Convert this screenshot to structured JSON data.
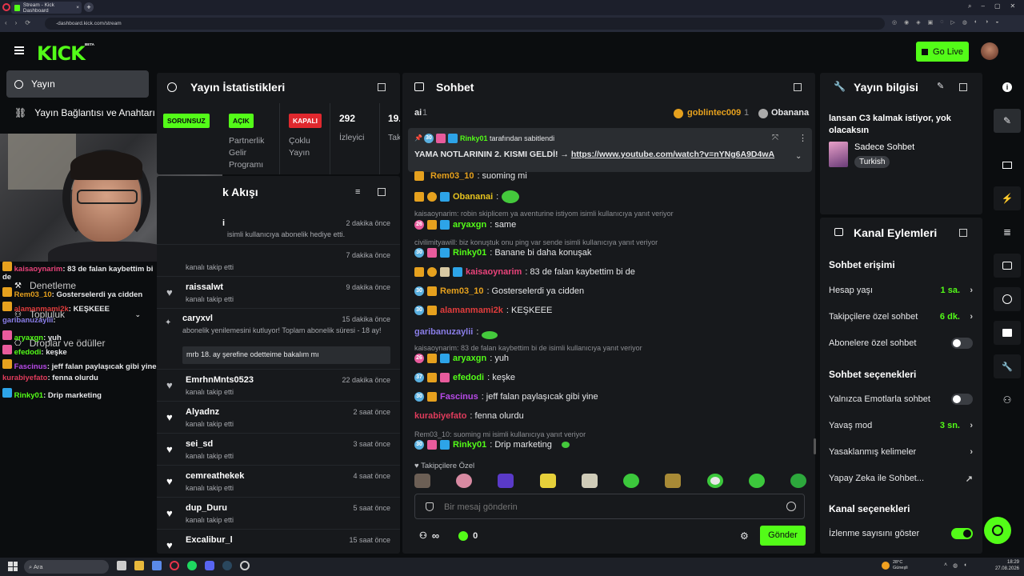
{
  "browser": {
    "tab_title": "Stream - Kick Dashboard",
    "url": "-dashboard.kick.com/stream"
  },
  "header": {
    "logo": "KICK",
    "beta": "BETA",
    "go_live_label": "Go Live"
  },
  "sidebar": {
    "items": [
      {
        "label": "Yayın"
      },
      {
        "label": "Yayın Bağlantısı ve Anahtarı"
      },
      {
        "label": "Denetleme"
      },
      {
        "label": "Topluluk"
      },
      {
        "label": "Droplar ve ödüller"
      }
    ]
  },
  "overlay_chat": {
    "lines": [
      {
        "user": "kaisaoynarim",
        "text": ": 83 de falan kaybettim bi"
      },
      {
        "user": "",
        "text": "de"
      },
      {
        "user": "Rem03_10",
        "text": ": Gosterselerdi ya cidden"
      },
      {
        "user": "alamanmami2k",
        "text": ": KEŞKEEE"
      },
      {
        "user": "garibanuzaylii",
        "text": ":"
      },
      {
        "user": "aryaxgn",
        "text": ": yuh"
      },
      {
        "user": "efedodi",
        "text": ": keşke"
      },
      {
        "user": "Fascinus",
        "text": ": jeff falan paylaşıcak gibi yine"
      },
      {
        "user": "kurabiyefato",
        "text": ": fenna olurdu"
      },
      {
        "user": "Rinky01",
        "text": ": Drip marketing"
      }
    ]
  },
  "stats": {
    "title": "Yayın İstatistikleri",
    "badges": [
      "SORUNSUZ",
      "AÇIK",
      "KAPALI"
    ],
    "partner_label": "Partnerlik Gelir Programı",
    "multi_label": "Çoklu Yayın",
    "viewers": "292",
    "viewers_label": "İzleyici",
    "partial_value": "19.",
    "partial_label": "Tak"
  },
  "activity": {
    "title": "k Akışı",
    "rows": [
      {
        "name": "i",
        "sub": "isimli kullanıcıya abonelik hediye etti.",
        "time": "2 dakika önce"
      },
      {
        "name": "",
        "sub": "kanalı takip etti",
        "time": "7 dakika önce"
      },
      {
        "name": "raissalwt",
        "sub": "kanalı takip etti",
        "time": "9 dakika önce"
      },
      {
        "name": "caryxvl",
        "sub": "abonelik yenilemesini kutluyor! Toplam abonelik süresi - 18 ay!",
        "time": "15 dakika önce",
        "message": "mrb 18. ay şerefine odetteime bakalım mı"
      },
      {
        "name": "EmrhnMnts0523",
        "sub": "kanalı takip etti",
        "time": "22 dakika önce"
      },
      {
        "name": "Alyadnz",
        "sub": "kanalı takip etti",
        "time": "2 saat önce"
      },
      {
        "name": "sei_sd",
        "sub": "kanalı takip etti",
        "time": "3 saat önce"
      },
      {
        "name": "cemreathekek",
        "sub": "kanalı takip etti",
        "time": "4 saat önce"
      },
      {
        "name": "dup_Duru",
        "sub": "kanalı takip etti",
        "time": "5 saat önce"
      },
      {
        "name": "Excalibur_l",
        "sub": "",
        "time": "15 saat önce"
      }
    ]
  },
  "chat": {
    "title": "Sohbet",
    "top_users": [
      {
        "name": "ai",
        "count": "1"
      },
      {
        "name": "goblintec009",
        "count": "1"
      },
      {
        "name": "Obanana",
        "count": ""
      }
    ],
    "pinned": {
      "by": "Rinky01",
      "suffix": "tarafından sabitlendi",
      "text": "YAMA NOTLARININ 2. KISMI GELDİ! →",
      "link": "https://www.youtube.com/watch?v=nYNg6A9D4wA"
    },
    "messages": [
      {
        "user": "Rem03_10",
        "color": "#e6a11e",
        "text": ": suoming mi"
      },
      {
        "user": "Obananai",
        "color": "#e6c21e",
        "text": ":"
      },
      {
        "reply": "kaisaoynarim: robin skiplicem ya aventurine istiyom isimli kullanıcıya yanıt veriyor"
      },
      {
        "user": "aryaxgn",
        "color": "#53fc18",
        "text": ": same"
      },
      {
        "reply": "civilimityawill: biz konuştuk onu ping var sende isimli kullanıcıya yanıt veriyor"
      },
      {
        "user": "Rinky01",
        "color": "#53fc18",
        "text": ": Banane bi daha konuşak"
      },
      {
        "user": "kaisaoynarim",
        "color": "#e8437a",
        "text": ": 83 de falan kaybettim bi de"
      },
      {
        "user": "Rem03_10",
        "color": "#e6a11e",
        "text": ": Gosterselerdi ya cidden"
      },
      {
        "user": "alamanmami2k",
        "color": "#e03c3c",
        "text": ": KEŞKEEE"
      },
      {
        "user": "garibanuzaylii",
        "color": "#8a7ee8",
        "text": ":"
      },
      {
        "reply": "kaisaoynarim: 83 de falan kaybettim bi de isimli kullanıcıya yanıt veriyor"
      },
      {
        "user": "aryaxgn",
        "color": "#53fc18",
        "text": ": yuh"
      },
      {
        "user": "efedodi",
        "color": "#53fc18",
        "text": ": keşke"
      },
      {
        "user": "Fascinus",
        "color": "#b84ae8",
        "text": ": jeff falan paylaşıcak gibi yine"
      },
      {
        "user": "kurabiyefato",
        "color": "#e03c5c",
        "text": ": fenna olurdu"
      },
      {
        "reply": "Rem03_10: suoming mi isimli kullanıcıya yanıt veriyor"
      },
      {
        "user": "Rinky01",
        "color": "#53fc18",
        "text": ": Drip marketing"
      }
    ],
    "follower_emotes_label": "Takipçilere Özel",
    "input_placeholder": "Bir mesaj gönderin",
    "points": "0",
    "send_label": "Gönder"
  },
  "stream_info": {
    "title": "Yayın bilgisi",
    "stream_title": "lansan C3 kalmak istiyor, yok olacaksın",
    "category": "Sadece Sohbet",
    "language": "Turkish"
  },
  "channel_actions": {
    "title": "Kanal Eylemleri",
    "chat_access_h": "Sohbet erişimi",
    "account_age_label": "Hesap yaşı",
    "account_age_value": "1 sa.",
    "followers_only_label": "Takipçilere özel sohbet",
    "followers_only_value": "6 dk.",
    "subs_only_label": "Abonelere özel sohbet",
    "chat_options_h": "Sohbet seçenekleri",
    "emote_only_label": "Yalnızca Emotlarla sohbet",
    "slow_mode_label": "Yavaş mod",
    "slow_mode_value": "3 sn.",
    "banned_words_label": "Yasaklanmış kelimeler",
    "ai_label": "Yapay Zeka ile Sohbet...",
    "channel_options_h": "Kanal seçenekleri",
    "show_viewers_label": "İzlenme sayısını göster"
  },
  "taskbar": {
    "search_placeholder": "Ara",
    "weather_temp": "28°C",
    "weather_label": "Güneşli",
    "time": "18:29",
    "date": "27.08.2026"
  }
}
